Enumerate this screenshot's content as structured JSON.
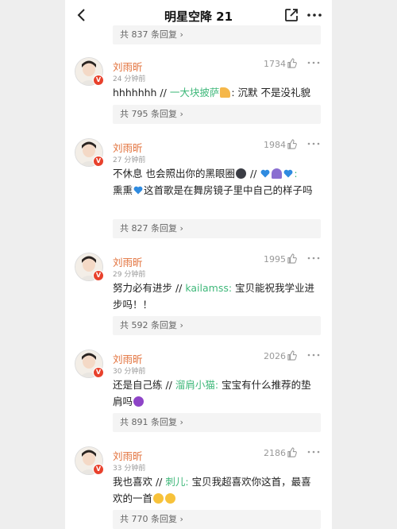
{
  "header": {
    "title": "明星空降 21"
  },
  "top_reply": {
    "label": "共 837 条回复 ›"
  },
  "comments": [
    {
      "name": "刘雨昕",
      "time": "24 分钟前",
      "likes": "1734",
      "text_a": "hhhhhhh // ",
      "link": "一大块披萨",
      "text_b": ": 沉默 不是没礼貌",
      "replies": "共 795 条回复 ›"
    },
    {
      "name": "刘雨昕",
      "time": "27 分钟前",
      "likes": "1984",
      "text_a": "不休息 也会照出你的黑眼圈",
      "text_mid": " // ",
      "link": ":",
      "text_b": "熏熏",
      "text_c": "这首歌是在舞房镜子里中自己的样子吗",
      "replies": "共 827 条回复 ›"
    },
    {
      "name": "刘雨昕",
      "time": "29 分钟前",
      "likes": "1995",
      "text_a": "努力必有进步 // ",
      "link": "kailamss:",
      "text_b": " 宝贝能祝我学业进步吗！！",
      "replies": "共 592 条回复 ›"
    },
    {
      "name": "刘雨昕",
      "time": "30 分钟前",
      "likes": "2026",
      "text_a": "还是自己练 // ",
      "link": "溜肩小猫:",
      "text_b": " 宝宝有什么推荐的垫肩吗",
      "replies": "共 891 条回复 ›"
    },
    {
      "name": "刘雨昕",
      "time": "33 分钟前",
      "likes": "2186",
      "text_a": "我也喜欢 // ",
      "link": "刺儿:",
      "text_b": " 宝贝我超喜欢你这首，最喜欢的一首",
      "replies": "共 770 条回复 ›"
    }
  ],
  "colors": {
    "name": "#e2703a",
    "link": "#3fb87a",
    "badge": "#e8412c"
  }
}
